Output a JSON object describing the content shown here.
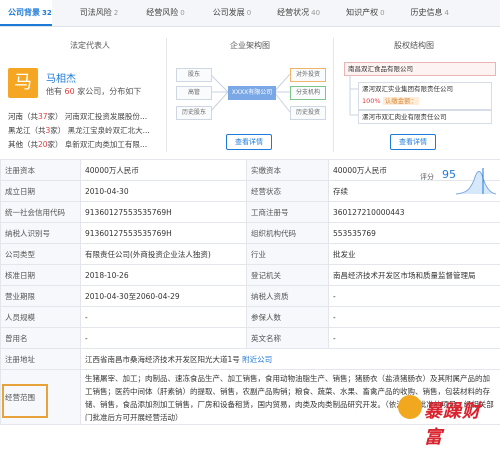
{
  "tabs": [
    {
      "label": "公司背景",
      "count": "32",
      "active": true
    },
    {
      "label": "司法风险",
      "count": "2",
      "active": false
    },
    {
      "label": "经营风险",
      "count": "0",
      "active": false
    },
    {
      "label": "公司发展",
      "count": "0",
      "active": false
    },
    {
      "label": "经营状况",
      "count": "40",
      "active": false
    },
    {
      "label": "知识产权",
      "count": "0",
      "active": false
    },
    {
      "label": "历史信息",
      "count": "4",
      "active": false
    }
  ],
  "legal_rep": {
    "section_title": "法定代表人",
    "avatar_char": "马",
    "name": "马相杰",
    "sub_prefix": "他有",
    "sub_count": "60",
    "sub_suffix": "家公司，分布如下",
    "rows": [
      {
        "prov": "河南（共",
        "num": "37",
        "rest": "家） 河南双汇投资发展股份..."
      },
      {
        "prov": "黑龙江（共",
        "num": "3",
        "rest": "家） 黑龙江宝泉岭双汇北大..."
      },
      {
        "prov": "其他（共",
        "num": "20",
        "rest": "家） 阜新双汇肉类加工有限..."
      }
    ]
  },
  "org_chart": {
    "section_title": "企业架构图",
    "center": "XXXX有限公司",
    "left_boxes": [
      "股东",
      "高管",
      "历史股东"
    ],
    "right_boxes": [
      "对外投资",
      "分支机构",
      "历史投资"
    ],
    "button": "查看详情"
  },
  "equity": {
    "section_title": "股权结构图",
    "top": "南昌双汇食品有限公司",
    "row1_name": "漯河双汇实业集团有限责任公司",
    "row1_pct": "100%",
    "row1_tag": "认缴金额：",
    "row2_name": "漯河市双汇肉业有限责任公司",
    "button": "查看详情"
  },
  "score": {
    "label": "评分",
    "value": "95"
  },
  "info": {
    "reg_capital_label": "注册资本",
    "reg_capital": "40000万人民币",
    "paid_capital_label": "实缴资本",
    "paid_capital": "40000万人民币",
    "founded_label": "成立日期",
    "founded": "2010-04-30",
    "status_label": "经营状态",
    "status": "存续",
    "credit_code_label": "统一社会信用代码",
    "credit_code": "913601275535357​69H",
    "reg_no_label": "工商注册号",
    "reg_no": "360127210000443",
    "taxpayer_label": "纳税人识别号",
    "taxpayer": "913601275535357​69H",
    "org_code_label": "组织机构代码",
    "org_code": "553535769",
    "type_label": "公司类型",
    "type": "有限责任公司(外商投资企业法人独资)",
    "industry_label": "行业",
    "industry": "批发业",
    "approval_label": "核准日期",
    "approval": "2018-10-26",
    "authority_label": "登记机关",
    "authority": "南昌经济技术开发区市场和质量监督管理局",
    "term_label": "营业期限",
    "term": "2010-04-30至2060-04-29",
    "taxpayer_q_label": "纳税人资质",
    "taxpayer_q": "-",
    "staff_label": "人员规模",
    "staff": "-",
    "insured_label": "参保人数",
    "insured": "-",
    "former_label": "曾用名",
    "former": "-",
    "en_name_label": "英文名称",
    "en_name": "-",
    "address_label": "注册地址",
    "address": "江西省南昌市桑海经济技术开发区阳光大道1号",
    "address_link": "附近公司",
    "scope_label": "经营范围",
    "scope": "生猪屠宰、加工；肉制品、速冻食品生产、加工销售，食用动物油脂生产、销售；猪肠衣（盐渍猪肠衣）及其附属产品的加工销售；医药中间体（肝素钠）的提取、销售，农副产品购销；粮食、蔬菜、水果、畜禽产品的收购、销售，包装材料的存储、销售，食品添加剂加工销售，厂房和设备租赁，国内贸易，肉类及肉类制品研究开发。（依法须经批准的项目，经相关部门批准后方可开展经营活动）"
  },
  "stamp_text": "暴躁财富"
}
